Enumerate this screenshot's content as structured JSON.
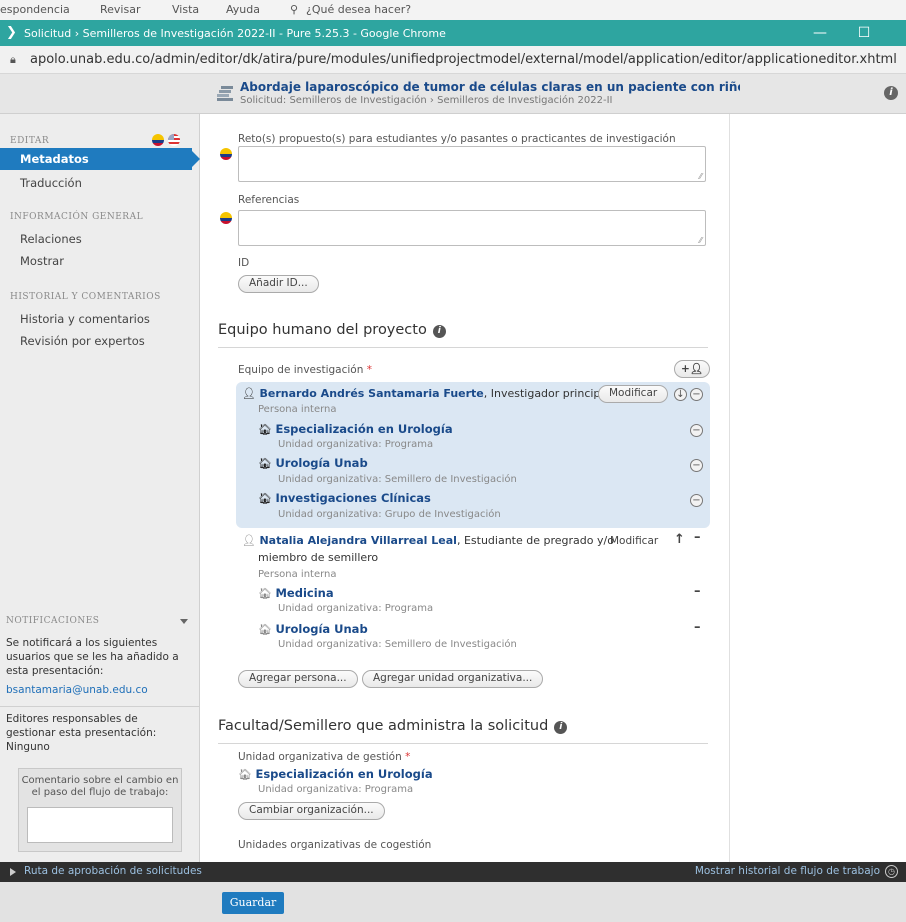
{
  "word_menu": {
    "items": [
      "espondencia",
      "Revisar",
      "Vista",
      "Ayuda",
      "¿Qué desea hacer?"
    ]
  },
  "browser": {
    "title": "Solicitud › Semilleros de Investigación 2022-II - Pure 5.25.3 - Google Chrome",
    "url": "apolo.unab.edu.co/admin/editor/dk/atira/pure/modules/unifiedprojectmodel/external/model/application/editor/applicationeditor.xhtml",
    "minimize": "—",
    "maximize": "☐"
  },
  "header": {
    "title": "Abordaje laparoscópico de tumor de células claras en un paciente con riñón en herradura",
    "subtitle": "Solicitud: Semilleros de Investigación › Semilleros de Investigación 2022-II",
    "info": "i"
  },
  "sidebar": {
    "editar": "EDITAR",
    "metadatos": "Metadatos",
    "traduccion": "Traducción",
    "info_general": "INFORMACIÓN GENERAL",
    "relaciones": "Relaciones",
    "mostrar": "Mostrar",
    "historial": "HISTORIAL Y COMENTARIOS",
    "historia": "Historia y comentarios",
    "revision": "Revisión por expertos",
    "notif_title": "NOTIFICACIONES",
    "notif_text": "Se notificará a los siguientes usuarios que se les ha añadido a esta presentación:",
    "notif_email": "bsantamaria@unab.edu.co",
    "editors_text": "Editores responsables de gestionar esta presentación:",
    "editors_value": "Ninguno",
    "comment_label": "Comentario sobre el cambio en el paso del flujo de trabajo:"
  },
  "main": {
    "retos_label": "Reto(s) propuesto(s) para estudiantes y/o pasantes o practicantes de investigación",
    "referencias_label": "Referencias",
    "id_label": "ID",
    "add_id": "Añadir ID...",
    "team_section": "Equipo humano del proyecto",
    "team_label": "Equipo de investigación",
    "required_mark": "*",
    "person1_name": "Bernardo Andrés Santamaria Fuerte",
    "person1_role": ", Investigador principal",
    "person1_type": "Persona interna",
    "modify": "Modificar",
    "org1_name": "Especialización en Urología",
    "org1_type": "Unidad organizativa: Programa",
    "org2_name": "Urología Unab",
    "org2_type": "Unidad organizativa: Semillero de Investigación",
    "org3_name": "Investigaciones Clínicas",
    "org3_type": "Unidad organizativa: Grupo de Investigación",
    "person2_name": "Natalia Alejandra Villarreal Leal",
    "person2_role_1": ", Estudiante de pregrado y/o",
    "person2_role_2": "miembro de semillero",
    "person2_type": "Persona interna",
    "org4_name": "Medicina",
    "org4_type": "Unidad organizativa: Programa",
    "org5_name": "Urología Unab",
    "org5_type": "Unidad organizativa: Semillero de Investigación",
    "add_person": "Agregar persona...",
    "add_unit": "Agregar unidad organizativa...",
    "faculty_section": "Facultad/Semillero que administra la solicitud",
    "mgmt_unit_label": "Unidad organizativa de gestión",
    "mgmt_org_name": "Especialización en Urología",
    "mgmt_org_type": "Unidad organizativa: Programa",
    "change_org": "Cambiar organización...",
    "cogestion_label": "Unidades organizativas de cogestión"
  },
  "footer": {
    "workflow_left": "Ruta de aprobación de solicitudes",
    "workflow_right": "Mostrar historial de flujo de trabajo",
    "save": "Guardar"
  }
}
